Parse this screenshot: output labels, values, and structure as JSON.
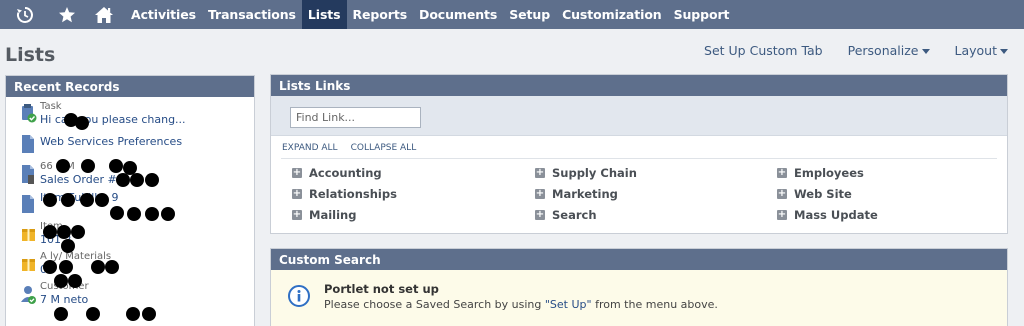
{
  "nav": {
    "items": [
      {
        "label": "Activities",
        "active": false
      },
      {
        "label": "Transactions",
        "active": false
      },
      {
        "label": "Lists",
        "active": true
      },
      {
        "label": "Reports",
        "active": false
      },
      {
        "label": "Documents",
        "active": false
      },
      {
        "label": "Setup",
        "active": false
      },
      {
        "label": "Customization",
        "active": false
      },
      {
        "label": "Support",
        "active": false
      }
    ],
    "icons": [
      "recent-history-icon",
      "star-icon",
      "home-icon"
    ]
  },
  "page": {
    "title": "Lists",
    "links": {
      "custom_tab": "Set Up Custom Tab",
      "personalize": "Personalize",
      "layout": "Layout"
    }
  },
  "recent_records": {
    "title": "Recent Records",
    "items": [
      {
        "type": "Task",
        "label": "Hi        can you please chang...",
        "icon": "task-icon"
      },
      {
        "type": "",
        "label": "Web Services Preferences",
        "icon": "document-icon"
      },
      {
        "type": "66   C      M",
        "label": "Sales Order #        2",
        "icon": "sales-order-icon"
      },
      {
        "type": "",
        "label": "Item Fulfillm        9",
        "icon": "document-icon"
      },
      {
        "type": "         Item",
        "label": "101  2",
        "icon": "item-box-icon"
      },
      {
        "type": "A       ly/     Materials",
        "label": "  05",
        "icon": "item-box-icon"
      },
      {
        "type": "Customer",
        "label": "   7 M   neto",
        "icon": "customer-icon"
      }
    ]
  },
  "lists_links": {
    "title": "Lists Links",
    "search_placeholder": "Find Link...",
    "expand_all": "EXPAND ALL",
    "collapse_all": "COLLAPSE ALL",
    "columns": [
      [
        "Accounting",
        "Relationships",
        "Mailing"
      ],
      [
        "Supply Chain",
        "Marketing",
        "Search"
      ],
      [
        "Employees",
        "Web Site",
        "Mass Update"
      ]
    ]
  },
  "custom_search": {
    "title": "Custom Search",
    "message_title": "Portlet not set up",
    "message_prefix": "Please choose a Saved Search by using ",
    "message_quoted": "\"Set Up\"",
    "message_suffix": " from the menu above."
  },
  "colors": {
    "nav_bg": "#5e6f8c",
    "nav_active": "#243a5e",
    "link": "#264c86",
    "notice_bg": "#fdfbe9"
  }
}
